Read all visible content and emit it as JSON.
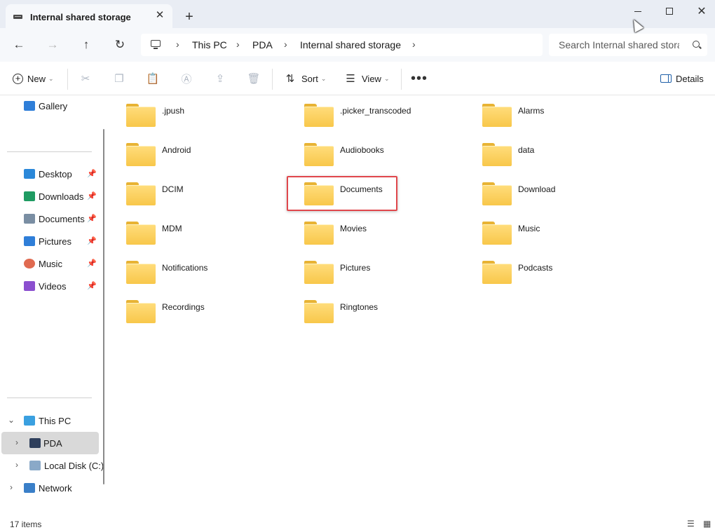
{
  "window": {
    "tab_title": "Internal shared storage",
    "tab_close": "✕",
    "new_tab": "+",
    "minimize": "minimize",
    "maximize": "maximize",
    "close": "✕"
  },
  "nav": {
    "back": "←",
    "forward": "→",
    "up": "↑",
    "refresh": "↻",
    "breadcrumb": [
      "This PC",
      "PDA",
      "Internal shared storage"
    ],
    "separator": "›",
    "search_placeholder": "Search Internal shared storage"
  },
  "toolbar": {
    "new_label": "New",
    "sort_label": "Sort",
    "view_label": "View",
    "more": "•••",
    "details_label": "Details",
    "icons": [
      "cut-icon",
      "copy-icon",
      "paste-icon",
      "rename-icon",
      "share-icon",
      "delete-icon"
    ]
  },
  "sidebar": {
    "gallery": "Gallery",
    "quick_access": [
      {
        "label": "Desktop",
        "icon": "desktop-icon",
        "color": "#2b88d9"
      },
      {
        "label": "Downloads",
        "icon": "download-icon",
        "color": "#1f9b62"
      },
      {
        "label": "Documents",
        "icon": "document-icon",
        "color": "#7a8ea3"
      },
      {
        "label": "Pictures",
        "icon": "pictures-icon",
        "color": "#2f7ed8"
      },
      {
        "label": "Music",
        "icon": "music-icon",
        "color": "#e06a50"
      },
      {
        "label": "Videos",
        "icon": "videos-icon",
        "color": "#8b4fcf"
      }
    ],
    "this_pc": "This PC",
    "pda": "PDA",
    "local_disk": "Local Disk (C:)",
    "network": "Network"
  },
  "folders": [
    ".jpush",
    ".picker_transcoded",
    "Alarms",
    "Android",
    "Audiobooks",
    "data",
    "DCIM",
    "Documents",
    "Download",
    "MDM",
    "Movies",
    "Music",
    "Notifications",
    "Pictures",
    "Podcasts",
    "Recordings",
    "Ringtones"
  ],
  "highlighted_folder": "Documents",
  "status": {
    "item_count": "17 items"
  },
  "colors": {
    "titlebar_bg": "#e9edf4",
    "folder_yellow": "#f8c74a",
    "highlight_red": "#e0474c",
    "selection_gray": "#d9d9d9"
  }
}
